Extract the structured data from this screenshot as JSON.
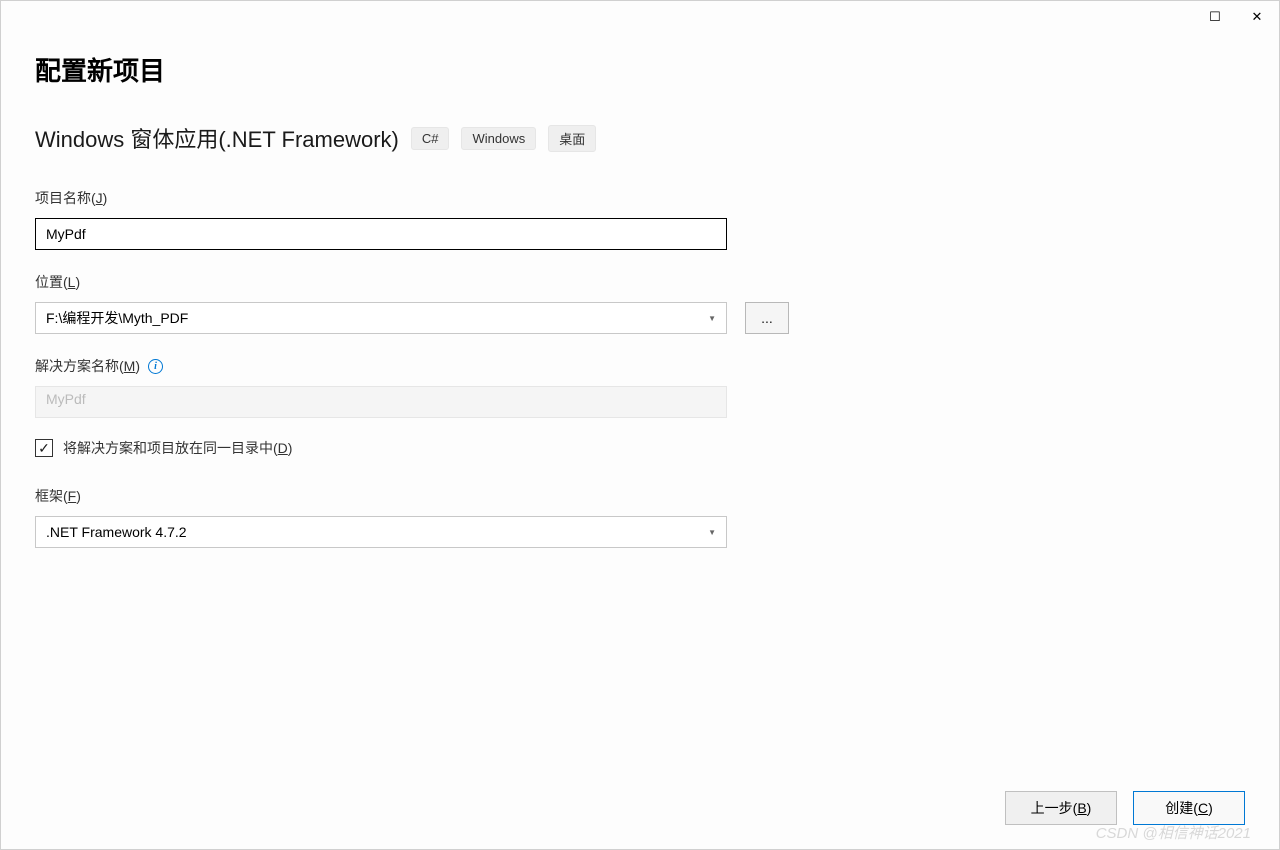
{
  "header": {
    "page_title": "配置新项目",
    "subtitle": "Windows 窗体应用(.NET Framework)",
    "tags": [
      "C#",
      "Windows",
      "桌面"
    ]
  },
  "fields": {
    "project_name": {
      "label_pre": "项目名称(",
      "label_key": "J",
      "label_post": ")",
      "value": "MyPdf"
    },
    "location": {
      "label_pre": "位置(",
      "label_key": "L",
      "label_post": ")",
      "value": "F:\\编程开发\\Myth_PDF",
      "browse": "..."
    },
    "solution_name": {
      "label_pre": "解决方案名称(",
      "label_key": "M",
      "label_post": ")",
      "placeholder": "MyPdf"
    },
    "same_dir": {
      "checked": true,
      "label_pre": "将解决方案和项目放在同一目录中(",
      "label_key": "D",
      "label_post": ")"
    },
    "framework": {
      "label_pre": "框架(",
      "label_key": "F",
      "label_post": ")",
      "value": ".NET Framework 4.7.2"
    }
  },
  "footer": {
    "back_pre": "上一步(",
    "back_key": "B",
    "back_post": ")",
    "create_pre": "创建(",
    "create_key": "C",
    "create_post": ")"
  },
  "watermark": "CSDN @相信神话2021",
  "icons": {
    "checkmark": "✓",
    "info": "i",
    "dropdown": "▼",
    "maximize": "☐",
    "close": "✕"
  }
}
